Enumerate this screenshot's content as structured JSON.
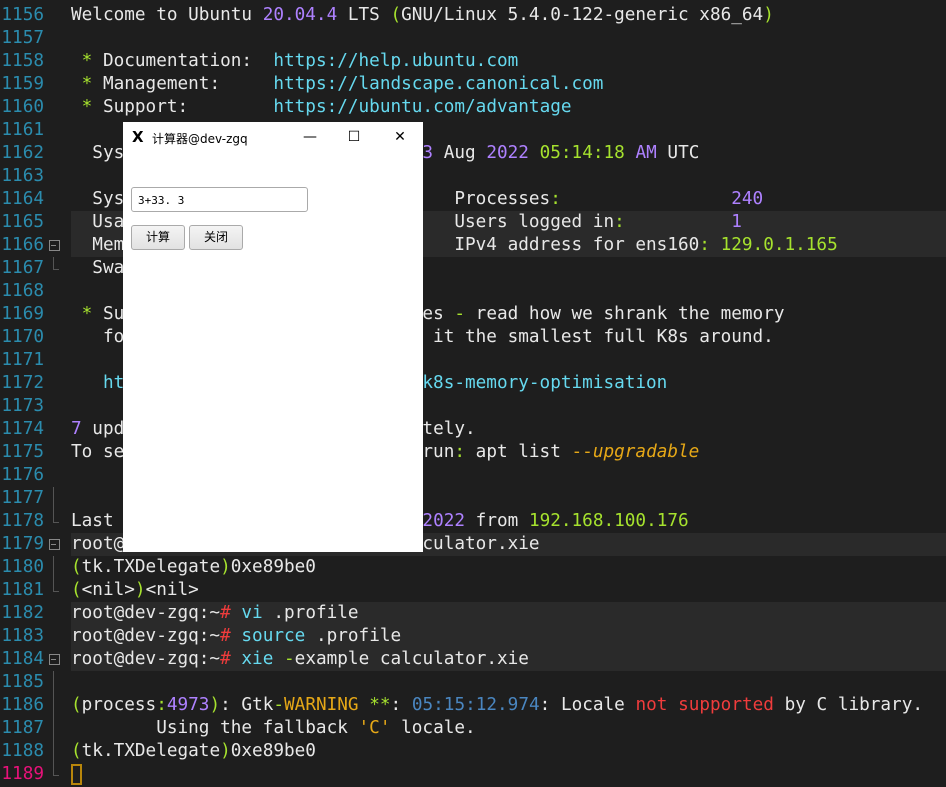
{
  "colors": {
    "background": "#1e1e1e",
    "line_number": "#2b8cae",
    "current_line_number": "#e8127a",
    "green": "#a6e22e",
    "purple": "#ae81ff",
    "cyan": "#66d9ef",
    "orange": "#e6a817",
    "red": "#f03c3c"
  },
  "terminal": {
    "lines": [
      {
        "n": "1156",
        "fold": "",
        "hl": false,
        "seg": [
          [
            "Welcome to Ubuntu ",
            "w"
          ],
          [
            "20.04.4",
            "p"
          ],
          [
            " LTS ",
            "w"
          ],
          [
            "(",
            "g"
          ],
          [
            "GNU/Linux 5.4.0-122-generic x86_64",
            "w"
          ],
          [
            ")",
            "g"
          ]
        ]
      },
      {
        "n": "1157",
        "fold": "",
        "hl": false,
        "seg": []
      },
      {
        "n": "1158",
        "fold": "",
        "hl": false,
        "seg": [
          [
            " * ",
            "g"
          ],
          [
            "Documentation:  ",
            "w"
          ],
          [
            "https://help.ubuntu.com",
            "c"
          ]
        ]
      },
      {
        "n": "1159",
        "fold": "",
        "hl": false,
        "seg": [
          [
            " * ",
            "g"
          ],
          [
            "Management:     ",
            "w"
          ],
          [
            "https://landscape.canonical.com",
            "c"
          ]
        ]
      },
      {
        "n": "1160",
        "fold": "",
        "hl": false,
        "seg": [
          [
            " * ",
            "g"
          ],
          [
            "Support:        ",
            "w"
          ],
          [
            "https://ubuntu.com/advantage",
            "c"
          ]
        ]
      },
      {
        "n": "1161",
        "fold": "",
        "hl": false,
        "seg": []
      },
      {
        "n": "1162",
        "fold": "",
        "hl": false,
        "seg": [
          [
            "  Sys                            ",
            "w"
          ],
          [
            "3",
            "p"
          ],
          [
            " Aug ",
            "w"
          ],
          [
            "2022",
            "p"
          ],
          [
            " ",
            "w"
          ],
          [
            "05:14:18",
            "g"
          ],
          [
            " ",
            "w"
          ],
          [
            "AM",
            "p"
          ],
          [
            " UTC",
            "w"
          ]
        ]
      },
      {
        "n": "1163",
        "fold": "",
        "hl": false,
        "seg": []
      },
      {
        "n": "1164",
        "fold": "",
        "hl": false,
        "seg": [
          [
            "  Sys                               Processes",
            "w"
          ],
          [
            ":",
            "g"
          ],
          [
            "                ",
            "w"
          ],
          [
            "240",
            "p"
          ]
        ]
      },
      {
        "n": "1165",
        "fold": "",
        "hl": true,
        "seg": [
          [
            "  Usa                               Users logged in",
            "w"
          ],
          [
            ":",
            "g"
          ],
          [
            "          ",
            "w"
          ],
          [
            "1",
            "p"
          ]
        ]
      },
      {
        "n": "1166",
        "fold": "box",
        "hl": true,
        "seg": [
          [
            "  Mem                               IPv4 address for ens160",
            "w"
          ],
          [
            ":",
            "g"
          ],
          [
            " ",
            "w"
          ],
          [
            "129.0.1.165",
            "g"
          ]
        ]
      },
      {
        "n": "1167",
        "fold": "end",
        "hl": false,
        "seg": [
          [
            "  Swa",
            "w"
          ]
        ]
      },
      {
        "n": "1168",
        "fold": "",
        "hl": false,
        "seg": []
      },
      {
        "n": "1169",
        "fold": "",
        "hl": false,
        "seg": [
          [
            " * ",
            "g"
          ],
          [
            "Su                           ces ",
            "w"
          ],
          [
            "-",
            "g"
          ],
          [
            " read how we shrank the memory",
            "w"
          ]
        ]
      },
      {
        "n": "1170",
        "fold": "",
        "hl": false,
        "seg": [
          [
            "   fo                             it the smallest full K8s around.",
            "w"
          ]
        ]
      },
      {
        "n": "1171",
        "fold": "",
        "hl": false,
        "seg": []
      },
      {
        "n": "1172",
        "fold": "",
        "hl": false,
        "seg": [
          [
            "   ht                            k8s-memory-optimisation",
            "c"
          ]
        ]
      },
      {
        "n": "1173",
        "fold": "",
        "hl": false,
        "seg": []
      },
      {
        "n": "1174",
        "fold": "",
        "hl": false,
        "seg": [
          [
            "7",
            "p"
          ],
          [
            " upd                            tely.",
            "w"
          ]
        ]
      },
      {
        "n": "1175",
        "fold": "",
        "hl": false,
        "seg": [
          [
            "To se                            run",
            "w"
          ],
          [
            ":",
            "g"
          ],
          [
            " apt list ",
            "w"
          ],
          [
            "--",
            "o"
          ],
          [
            "upgradable",
            "oi"
          ]
        ]
      },
      {
        "n": "1176",
        "fold": "",
        "hl": false,
        "seg": []
      },
      {
        "n": "1177",
        "fold": "line",
        "hl": false,
        "seg": []
      },
      {
        "n": "1178",
        "fold": "end",
        "hl": false,
        "seg": [
          [
            "Last                             ",
            "w"
          ],
          [
            "2022",
            "p"
          ],
          [
            " from ",
            "w"
          ],
          [
            "192.168.100.176",
            "g"
          ]
        ]
      },
      {
        "n": "1179",
        "fold": "box",
        "hl": true,
        "seg": [
          [
            "root@                            culator.xie",
            "w"
          ]
        ]
      },
      {
        "n": "1180",
        "fold": "line",
        "hl": false,
        "seg": [
          [
            "(",
            "g"
          ],
          [
            "tk.TXDelegate",
            "w"
          ],
          [
            ")",
            "g"
          ],
          [
            "0xe89be0",
            "w"
          ]
        ]
      },
      {
        "n": "1181",
        "fold": "end",
        "hl": false,
        "seg": [
          [
            "(",
            "g"
          ],
          [
            "<nil>",
            "w"
          ],
          [
            ")",
            "g"
          ],
          [
            "<nil>",
            "w"
          ]
        ]
      },
      {
        "n": "1182",
        "fold": "",
        "hl": true,
        "seg": [
          [
            "root@dev-zgq:~",
            "w"
          ],
          [
            "#",
            "r"
          ],
          [
            " ",
            "w"
          ],
          [
            "vi",
            "c"
          ],
          [
            " .profile",
            "w"
          ]
        ]
      },
      {
        "n": "1183",
        "fold": "",
        "hl": true,
        "seg": [
          [
            "root@dev-zgq:~",
            "w"
          ],
          [
            "#",
            "r"
          ],
          [
            " ",
            "w"
          ],
          [
            "source",
            "c"
          ],
          [
            " .profile",
            "w"
          ]
        ]
      },
      {
        "n": "1184",
        "fold": "box",
        "hl": true,
        "seg": [
          [
            "root@dev-zgq:~",
            "w"
          ],
          [
            "#",
            "r"
          ],
          [
            " ",
            "w"
          ],
          [
            "xie",
            "c"
          ],
          [
            " ",
            "w"
          ],
          [
            "-",
            "g"
          ],
          [
            "example calculator.xie",
            "w"
          ]
        ]
      },
      {
        "n": "1185",
        "fold": "line",
        "hl": false,
        "seg": []
      },
      {
        "n": "1186",
        "fold": "line",
        "hl": false,
        "seg": [
          [
            "(",
            "g"
          ],
          [
            "process",
            "w"
          ],
          [
            ":",
            "g"
          ],
          [
            "4973",
            "p"
          ],
          [
            ")",
            "g"
          ],
          [
            ": Gtk",
            "w"
          ],
          [
            "-",
            "g"
          ],
          [
            "WARNING",
            "o"
          ],
          [
            " **",
            "g"
          ],
          [
            ": ",
            "w"
          ],
          [
            "05:15:12.974",
            "b"
          ],
          [
            ": Locale ",
            "w"
          ],
          [
            "not supported",
            "r"
          ],
          [
            " by C library.",
            "w"
          ]
        ]
      },
      {
        "n": "1187",
        "fold": "line",
        "hl": false,
        "seg": [
          [
            "        Using the fallback ",
            "w"
          ],
          [
            "'C'",
            "o"
          ],
          [
            " locale.",
            "w"
          ]
        ]
      },
      {
        "n": "1188",
        "fold": "line",
        "hl": false,
        "seg": [
          [
            "(",
            "g"
          ],
          [
            "tk.TXDelegate",
            "w"
          ],
          [
            ")",
            "g"
          ],
          [
            "0xe89be0",
            "w"
          ]
        ]
      },
      {
        "n": "1189",
        "fold": "end",
        "hl": false,
        "cursor": true,
        "seg": []
      }
    ]
  },
  "popup": {
    "title": "计算器@dev-zgq",
    "app_icon": "x-window-icon",
    "input_value": "3+33. 3",
    "calc_button": "计算",
    "close_button": "关闭",
    "minimize": "—",
    "maximize": "☐",
    "close": "✕"
  }
}
